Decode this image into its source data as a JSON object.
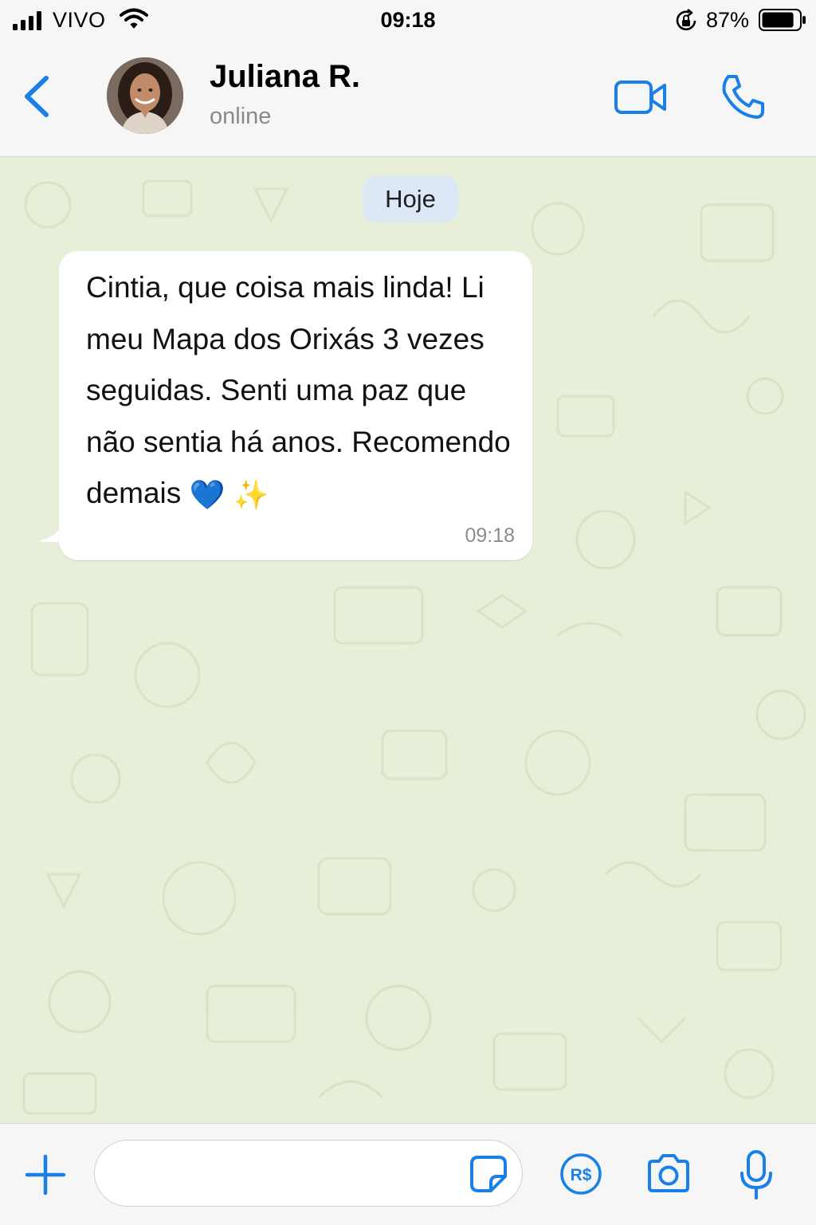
{
  "status_bar": {
    "carrier": "VIVO",
    "time": "09:18",
    "battery_percent": "87%",
    "battery_level": 0.87,
    "icons": [
      "signal-icon",
      "wifi-icon",
      "rotation-lock-icon",
      "battery-icon"
    ]
  },
  "header": {
    "contact_name": "Juliana R.",
    "contact_status": "online",
    "icons": [
      "back-chevron-icon",
      "video-camera-icon",
      "phone-icon"
    ]
  },
  "chat": {
    "date_separator": "Hoje",
    "messages": [
      {
        "text": "Cintia, que coisa mais linda! Li meu Mapa dos Orixás 3 vezes seguidas. Senti uma paz que não sentia há anos. Recomendo demais",
        "emojis": [
          "💙",
          "✨"
        ],
        "time": "09:18",
        "direction": "incoming"
      }
    ]
  },
  "input_bar": {
    "message_value": "",
    "icons": [
      "plus-icon",
      "sticker-icon",
      "pix-real-icon",
      "camera-icon",
      "microphone-icon"
    ]
  },
  "colors": {
    "accent": "#1a7fe6",
    "chat_background": "#e7efd9",
    "bubble_incoming": "#ffffff",
    "date_pill": "#dde8f6",
    "secondary_text": "#8a8a8e"
  }
}
